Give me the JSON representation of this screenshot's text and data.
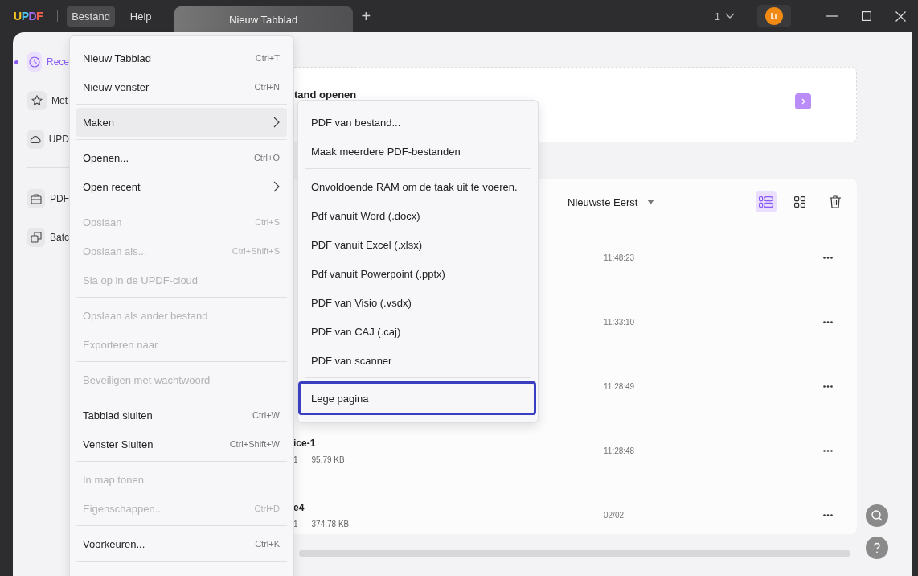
{
  "titlebar": {
    "logo": "UPDF",
    "menus": [
      {
        "label": "Bestand",
        "selected": true
      },
      {
        "label": "Help",
        "selected": false
      }
    ],
    "tabs": [
      {
        "label": "Nieuw Tabblad",
        "selected": true
      }
    ],
    "add_tab": "+",
    "window_count": "1"
  },
  "sidebar": {
    "items": [
      {
        "label": "Rece",
        "selected": true
      },
      {
        "label": "Met",
        "selected": false
      },
      {
        "label": "UPD",
        "selected": false
      },
      {
        "kind": "divider"
      },
      {
        "label": "PDF",
        "selected": false
      },
      {
        "label": "Batc",
        "selected": false
      }
    ]
  },
  "open_card": {
    "title": "tand openen"
  },
  "list": {
    "sort": "Nieuwste Eerst",
    "view_buttons": [
      {
        "selected": true
      },
      {
        "selected": false
      }
    ],
    "rows": [
      {
        "time": "11:48:23"
      },
      {
        "time": "11:33:10"
      },
      {
        "time": "11:28:49"
      },
      {
        "name": "ice-1",
        "meta": "1",
        "size": "95.79 KB",
        "time": "11:28:48"
      },
      {
        "name": "e4",
        "meta": "1",
        "size": "374.78 KB",
        "time": "02/02"
      }
    ]
  },
  "file_menu": [
    {
      "kind": "item",
      "label": "Nieuw Tabblad",
      "shortcut": "Ctrl+T",
      "disabled": false,
      "selected": false
    },
    {
      "kind": "item",
      "label": "Nieuw venster",
      "shortcut": "Ctrl+N",
      "disabled": false,
      "selected": false
    },
    {
      "kind": "separator"
    },
    {
      "kind": "submenu",
      "label": "Maken",
      "disabled": false,
      "selected": true
    },
    {
      "kind": "separator"
    },
    {
      "kind": "item",
      "label": "Openen...",
      "shortcut": "Ctrl+O",
      "disabled": false,
      "selected": false
    },
    {
      "kind": "submenu",
      "label": "Open recent",
      "disabled": false,
      "selected": false
    },
    {
      "kind": "separator"
    },
    {
      "kind": "item",
      "label": "Opslaan",
      "shortcut": "Ctrl+S",
      "disabled": true,
      "selected": false
    },
    {
      "kind": "item",
      "label": "Opslaan als...",
      "shortcut": "Ctrl+Shift+S",
      "disabled": true,
      "selected": false
    },
    {
      "kind": "item",
      "label": "Sla op in de UPDF-cloud",
      "disabled": true,
      "selected": false
    },
    {
      "kind": "separator"
    },
    {
      "kind": "item",
      "label": "Opslaan als ander bestand",
      "disabled": true,
      "selected": false
    },
    {
      "kind": "item",
      "label": "Exporteren naar",
      "disabled": true,
      "selected": false
    },
    {
      "kind": "separator"
    },
    {
      "kind": "item",
      "label": "Beveiligen met wachtwoord",
      "disabled": true,
      "selected": false
    },
    {
      "kind": "separator"
    },
    {
      "kind": "item",
      "label": "Tabblad sluiten",
      "shortcut": "Ctrl+W",
      "disabled": false,
      "selected": false
    },
    {
      "kind": "item",
      "label": "Venster Sluiten",
      "shortcut": "Ctrl+Shift+W",
      "disabled": false,
      "selected": false
    },
    {
      "kind": "separator"
    },
    {
      "kind": "item",
      "label": "In map tonen",
      "disabled": true,
      "selected": false
    },
    {
      "kind": "item",
      "label": "Eigenschappen...",
      "shortcut": "Ctrl+D",
      "disabled": true,
      "selected": false
    },
    {
      "kind": "separator"
    },
    {
      "kind": "item",
      "label": "Voorkeuren...",
      "shortcut": "Ctrl+K",
      "disabled": false,
      "selected": false
    },
    {
      "kind": "separator"
    }
  ],
  "create_submenu": [
    {
      "kind": "item",
      "label": "PDF van bestand...",
      "highlighted": false
    },
    {
      "kind": "item",
      "label": "Maak meerdere PDF-bestanden",
      "highlighted": false
    },
    {
      "kind": "separator"
    },
    {
      "kind": "item",
      "label": "Onvoldoende RAM om de taak uit te voeren.",
      "highlighted": false
    },
    {
      "kind": "item",
      "label": "Pdf vanuit Word (.docx)",
      "highlighted": false
    },
    {
      "kind": "item",
      "label": "PDF vanuit Excel (.xlsx)",
      "highlighted": false
    },
    {
      "kind": "item",
      "label": "Pdf vanuit Powerpoint (.pptx)",
      "highlighted": false
    },
    {
      "kind": "item",
      "label": "PDF van Visio (.vsdx)",
      "highlighted": false
    },
    {
      "kind": "item",
      "label": "PDF van CAJ (.caj)",
      "highlighted": false
    },
    {
      "kind": "item",
      "label": "PDF van scanner",
      "highlighted": false
    },
    {
      "kind": "separator"
    },
    {
      "kind": "item",
      "label": "Lege pagina",
      "highlighted": true
    }
  ]
}
